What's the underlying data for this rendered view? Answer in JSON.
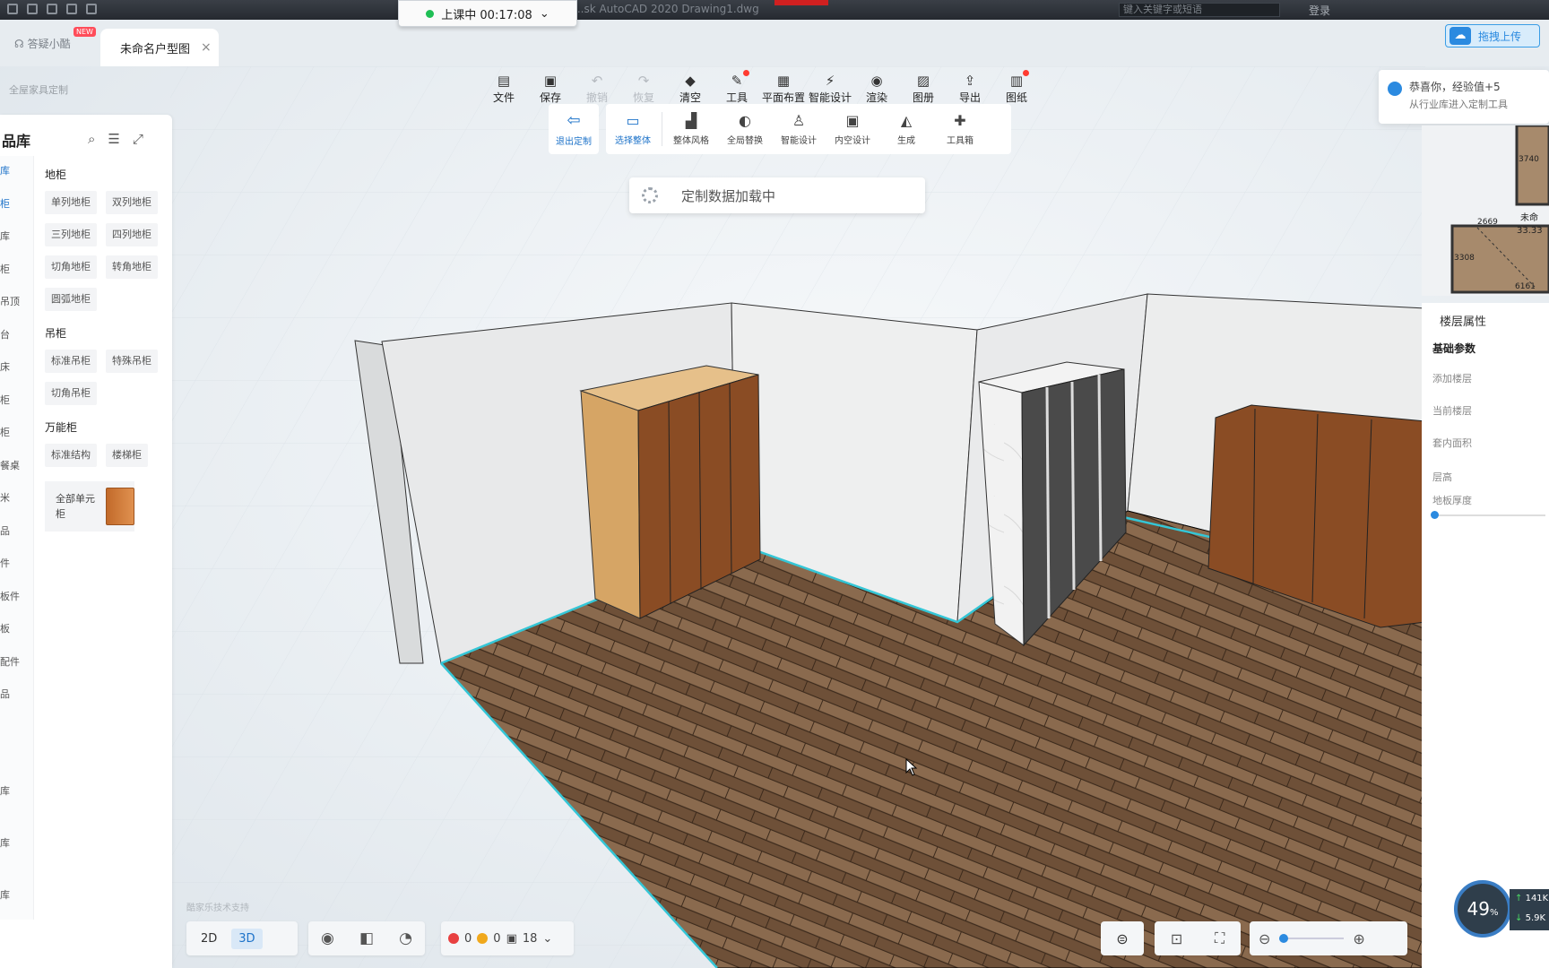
{
  "window": {
    "title": "...sk AutoCAD 2020    Drawing1.dwg",
    "search_placeholder": "键入关键字或短语",
    "login": "登录"
  },
  "class_timer": {
    "label": "上课中 00:17:08"
  },
  "tabs": {
    "help": "答疑小酷",
    "new_badge": "NEW",
    "active": "未命名户型图",
    "close": "×"
  },
  "cloud_upload": "拖拽上传",
  "breadcrumb": "全屋家具定制",
  "toolbar": [
    {
      "label": "文件",
      "icon": "file-icon",
      "glyph": "▤",
      "disabled": false,
      "dot": false
    },
    {
      "label": "保存",
      "icon": "save-icon",
      "glyph": "▣",
      "disabled": false,
      "dot": false
    },
    {
      "label": "撤销",
      "icon": "undo-icon",
      "glyph": "↶",
      "disabled": true,
      "dot": false
    },
    {
      "label": "恢复",
      "icon": "redo-icon",
      "glyph": "↷",
      "disabled": true,
      "dot": false
    },
    {
      "label": "清空",
      "icon": "eraser-icon",
      "glyph": "◆",
      "disabled": false,
      "dot": false
    },
    {
      "label": "工具",
      "icon": "wrench-icon",
      "glyph": "✎",
      "disabled": false,
      "dot": true
    },
    {
      "label": "平面布置",
      "icon": "layout-icon",
      "glyph": "▦",
      "disabled": false,
      "dot": false
    },
    {
      "label": "智能设计",
      "icon": "lightning-icon",
      "glyph": "⚡",
      "disabled": false,
      "dot": false
    },
    {
      "label": "渲染",
      "icon": "camera-icon",
      "glyph": "◉",
      "disabled": false,
      "dot": false
    },
    {
      "label": "图册",
      "icon": "album-icon",
      "glyph": "▨",
      "disabled": false,
      "dot": false
    },
    {
      "label": "导出",
      "icon": "export-icon",
      "glyph": "⇪",
      "disabled": false,
      "dot": false
    },
    {
      "label": "图纸",
      "icon": "drawing-icon",
      "glyph": "▥",
      "disabled": false,
      "dot": true
    }
  ],
  "subtoolbar": {
    "exit": "退出定制",
    "items": [
      {
        "label": "选择整体",
        "icon": "select-all-icon",
        "glyph": "▭",
        "active": true
      },
      {
        "label": "整体风格",
        "icon": "paint-roller-icon",
        "glyph": "▟",
        "active": false
      },
      {
        "label": "全局替换",
        "icon": "palette-icon",
        "glyph": "◐",
        "active": false
      },
      {
        "label": "智能设计",
        "icon": "smart-design-icon",
        "glyph": "♙",
        "active": false
      },
      {
        "label": "内空设计",
        "icon": "inner-space-icon",
        "glyph": "▣",
        "active": false
      },
      {
        "label": "生成",
        "icon": "generate-icon",
        "glyph": "◭",
        "active": false
      },
      {
        "label": "工具箱",
        "icon": "puzzle-icon",
        "glyph": "✚",
        "active": false
      }
    ]
  },
  "loading_text": "定制数据加载中",
  "library": {
    "title": "品库",
    "rail": [
      "库",
      "柜",
      "库",
      "柜",
      "吊顶",
      "台",
      "床",
      "柜",
      "柜",
      "餐桌",
      "米",
      "品",
      "件",
      "板件",
      "板",
      "配件",
      "品"
    ],
    "rail_bottom": [
      "库",
      "库",
      "库"
    ],
    "groups": [
      {
        "title": "地柜",
        "items": [
          "单列地柜",
          "双列地柜",
          "三列地柜",
          "四列地柜",
          "切角地柜",
          "转角地柜",
          "圆弧地柜"
        ]
      },
      {
        "title": "吊柜",
        "items": [
          "标准吊柜",
          "特殊吊柜",
          "切角吊柜"
        ]
      },
      {
        "title": "万能柜",
        "items": [
          "标准结构",
          "楼梯柜"
        ]
      }
    ],
    "all_units": "全部单元柜"
  },
  "notification": {
    "line1": "恭喜你，经验值+5",
    "line2": "从行业库进入定制工具"
  },
  "minimap": {
    "dims": [
      "3740",
      "2669",
      "3308",
      "6161"
    ],
    "room": "未命",
    "area": "33.33"
  },
  "floor_panel": {
    "title": "楼层属性",
    "section": "基础参数",
    "add_floor": "添加楼层",
    "current_floor": "当前楼层",
    "inner_area": "套内面积",
    "floor_height": "层高",
    "floor_thickness": "地板厚度"
  },
  "bottom": {
    "view_2d": "2D",
    "view_3d": "3D",
    "errors": "0",
    "warnings": "0",
    "items": "18",
    "watermark": "酷家乐技术支持"
  },
  "perf": {
    "percent": "49",
    "unit": "%",
    "up": "141",
    "down": "5.9",
    "speed_unit": "K"
  }
}
